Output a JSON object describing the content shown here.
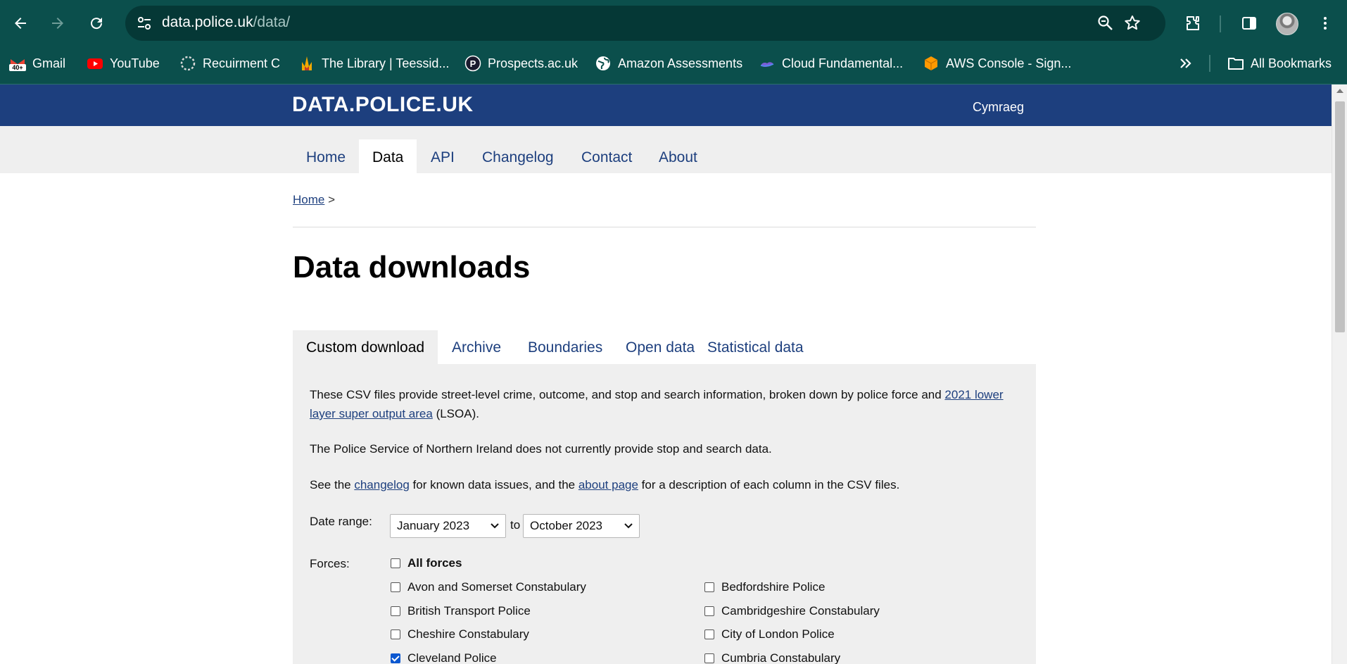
{
  "browser": {
    "url_host": "data.police.uk",
    "url_path": "/data/",
    "bookmarks": [
      {
        "label": "Gmail",
        "icon": "gmail-icon"
      },
      {
        "label": "YouTube",
        "icon": "youtube-icon"
      },
      {
        "label": "Recuirment C",
        "icon": "loading-ring-icon"
      },
      {
        "label": "The Library | Teessid...",
        "icon": "library-flame-icon"
      },
      {
        "label": "Prospects.ac.uk",
        "icon": "prospects-icon"
      },
      {
        "label": "Amazon Assessments",
        "icon": "globe-icon"
      },
      {
        "label": "Cloud Fundamental...",
        "icon": "cloud-icon"
      },
      {
        "label": "AWS Console - Sign...",
        "icon": "aws-cube-icon"
      }
    ],
    "all_bookmarks_label": "All Bookmarks",
    "gmail_badge": "40+"
  },
  "site": {
    "logo": "DATA.POLICE.UK",
    "language_link": "Cymraeg",
    "nav": [
      {
        "label": "Home",
        "active": false
      },
      {
        "label": "Data",
        "active": true
      },
      {
        "label": "API",
        "active": false
      },
      {
        "label": "Changelog",
        "active": false
      },
      {
        "label": "Contact",
        "active": false
      },
      {
        "label": "About",
        "active": false
      }
    ]
  },
  "breadcrumb": {
    "home": "Home",
    "separator": ">"
  },
  "page": {
    "title": "Data downloads",
    "tabs": [
      {
        "label": "Custom download",
        "active": true
      },
      {
        "label": "Archive",
        "active": false
      },
      {
        "label": "Boundaries",
        "active": false
      },
      {
        "label": "Open data",
        "active": false
      },
      {
        "label": "Statistical data",
        "active": false
      }
    ]
  },
  "panel": {
    "intro_text": "These CSV files provide street-level crime, outcome, and stop and search information, broken down by police force and ",
    "intro_link": "2021 lower layer super output area",
    "intro_suffix": " (LSOA).",
    "psni_text": "The Police Service of Northern Ireland does not currently provide stop and search data.",
    "see_prefix": "See the ",
    "changelog_link": "changelog",
    "see_middle": " for known data issues, and the ",
    "about_link": "about page",
    "see_suffix": " for a description of each column in the CSV files.",
    "date_range_label": "Date range:",
    "date_from": "January 2023",
    "date_to_word": "to",
    "date_to": "October 2023",
    "forces_label": "Forces:",
    "all_forces": "All forces",
    "forces": [
      {
        "label": "Avon and Somerset Constabulary",
        "checked": false
      },
      {
        "label": "Bedfordshire Police",
        "checked": false
      },
      {
        "label": "British Transport Police",
        "checked": false
      },
      {
        "label": "Cambridgeshire Constabulary",
        "checked": false
      },
      {
        "label": "Cheshire Constabulary",
        "checked": false
      },
      {
        "label": "City of London Police",
        "checked": false
      },
      {
        "label": "Cleveland Police",
        "checked": true
      },
      {
        "label": "Cumbria Constabulary",
        "checked": false
      }
    ]
  }
}
